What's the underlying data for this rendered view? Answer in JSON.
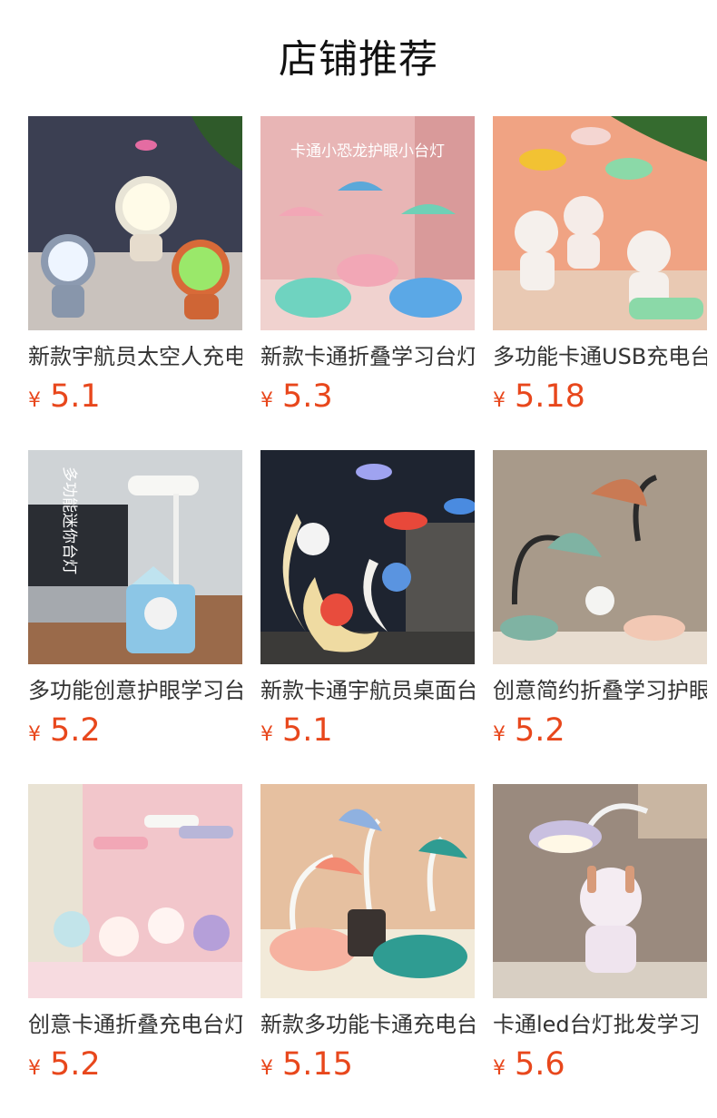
{
  "section": {
    "title": "店铺推荐"
  },
  "currency_symbol": "¥",
  "price_color": "#e8471c",
  "products": [
    {
      "name": "新款宇航员太空人充电台灯",
      "price": "5.1",
      "image_icon": "astronaut-lamp-image",
      "image_caption": ""
    },
    {
      "name": "新款卡通折叠学习台灯",
      "price": "5.3",
      "image_icon": "dinosaur-lamp-image",
      "image_caption": "卡通小恐龙护眼小台灯"
    },
    {
      "name": "多功能卡通USB充电台灯",
      "price": "5.18",
      "image_icon": "bear-lamp-image",
      "image_caption": ""
    },
    {
      "name": "多功能创意护眼学习台灯",
      "price": "5.2",
      "image_icon": "mini-lamp-image",
      "image_caption": "多功能迷你台灯"
    },
    {
      "name": "新款卡通宇航员桌面台灯",
      "price": "5.1",
      "image_icon": "moon-astronaut-lamp-image",
      "image_caption": ""
    },
    {
      "name": "创意简约折叠学习护眼台灯",
      "price": "5.2",
      "image_icon": "green-desk-lamp-image",
      "image_caption": ""
    },
    {
      "name": "创意卡通折叠充电台灯",
      "price": "5.2",
      "image_icon": "rabbit-lamp-image",
      "image_caption": ""
    },
    {
      "name": "新款多功能卡通充电台灯",
      "price": "5.15",
      "image_icon": "whale-lamp-image",
      "image_caption": ""
    },
    {
      "name": "卡通led台灯批发学习",
      "price": "5.6",
      "image_icon": "bunny-robot-lamp-image",
      "image_caption": ""
    }
  ]
}
